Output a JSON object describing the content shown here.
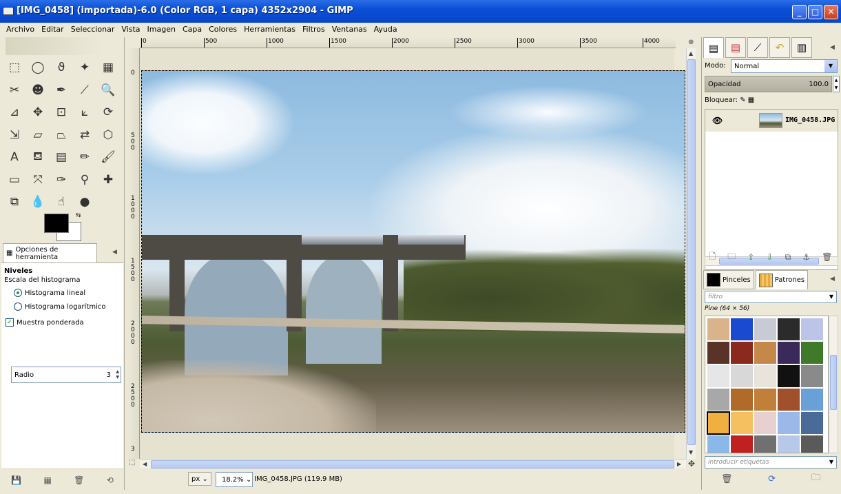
{
  "window": {
    "title": "[IMG_0458] (importada)-6.0 (Color RGB, 1 capa) 4352x2904 - GIMP",
    "minimize_glyph": "_",
    "maximize_glyph": "□",
    "close_glyph": "✕"
  },
  "menubar": [
    "Archivo",
    "Editar",
    "Seleccionar",
    "Vista",
    "Imagen",
    "Capa",
    "Colores",
    "Herramientas",
    "Filtros",
    "Ventanas",
    "Ayuda"
  ],
  "toolbox": {
    "tools": [
      {
        "name": "rect-select-icon",
        "glyph": "⬚"
      },
      {
        "name": "ellipse-select-icon",
        "glyph": "◯"
      },
      {
        "name": "free-select-icon",
        "glyph": "ϑ"
      },
      {
        "name": "fuzzy-select-icon",
        "glyph": "✦"
      },
      {
        "name": "select-by-color-icon",
        "glyph": "▦"
      },
      {
        "name": "scissors-select-icon",
        "glyph": "✂"
      },
      {
        "name": "foreground-select-icon",
        "glyph": "☻"
      },
      {
        "name": "paths-icon",
        "glyph": "✒"
      },
      {
        "name": "color-picker-icon",
        "glyph": "⟋"
      },
      {
        "name": "zoom-icon",
        "glyph": "🔍"
      },
      {
        "name": "measure-icon",
        "glyph": "⊿"
      },
      {
        "name": "move-icon",
        "glyph": "✥"
      },
      {
        "name": "align-icon",
        "glyph": "⊡"
      },
      {
        "name": "crop-icon",
        "glyph": "⟀"
      },
      {
        "name": "rotate-icon",
        "glyph": "⟳"
      },
      {
        "name": "scale-icon",
        "glyph": "⇲"
      },
      {
        "name": "shear-icon",
        "glyph": "▱"
      },
      {
        "name": "perspective-icon",
        "glyph": "⏢"
      },
      {
        "name": "flip-icon",
        "glyph": "⇄"
      },
      {
        "name": "cage-icon",
        "glyph": "⬡"
      },
      {
        "name": "text-icon",
        "glyph": "A"
      },
      {
        "name": "bucket-fill-icon",
        "glyph": "⛾"
      },
      {
        "name": "blend-icon",
        "glyph": "▤"
      },
      {
        "name": "pencil-icon",
        "glyph": "✏"
      },
      {
        "name": "paintbrush-icon",
        "glyph": "🖌"
      },
      {
        "name": "eraser-icon",
        "glyph": "▭"
      },
      {
        "name": "airbrush-icon",
        "glyph": "⤧"
      },
      {
        "name": "ink-icon",
        "glyph": "✑"
      },
      {
        "name": "clone-icon",
        "glyph": "⚲"
      },
      {
        "name": "heal-icon",
        "glyph": "✚"
      },
      {
        "name": "perspective-clone-icon",
        "glyph": "⧉"
      },
      {
        "name": "blur-icon",
        "glyph": "💧"
      },
      {
        "name": "smudge-icon",
        "glyph": "☝"
      },
      {
        "name": "dodge-burn-icon",
        "glyph": "●"
      }
    ],
    "swap_glyph": "⇆"
  },
  "tool_options": {
    "tab_label": "Opciones de herramienta",
    "close_glyph": "◀",
    "title": "Niveles",
    "subtitle": "Escala del histograma",
    "radio_linear": "Histograma lineal",
    "radio_log": "Histograma logarítmico",
    "check_label": "Muestra ponderada",
    "check_glyph": "✓",
    "radius_label": "Radio",
    "radius_value": "3"
  },
  "rulers": {
    "h_labels": [
      "0",
      "500",
      "1000",
      "1500",
      "2000",
      "2500",
      "3000",
      "3500",
      "4000"
    ],
    "v_labels": [
      "0",
      "500",
      "1000",
      "1500",
      "2000",
      "2500",
      "3"
    ]
  },
  "status": {
    "unit": "px",
    "zoom": "18.2%",
    "info": "IMG_0458.JPG (119.9 MB)"
  },
  "layers_panel": {
    "mode_label": "Modo:",
    "mode_value": "Normal",
    "opacity_label": "Opacidad",
    "opacity_value": "100.0",
    "lock_label": "Bloquear:",
    "layer_name": "IMG_0458.JPG",
    "close_glyph": "◀"
  },
  "brushes_panel": {
    "tab_brushes": "Pinceles",
    "tab_patterns": "Patrones",
    "filter_placeholder": "filtro",
    "pattern_name": "Pine (64 × 56)",
    "tags_placeholder": "introducir etiquetas",
    "close_glyph": "◀",
    "patterns": [
      "#d9b48a",
      "#1a4ad0",
      "#c9cbd4",
      "#2b2b2b",
      "#bcc4e8",
      "#5a3328",
      "#8a2a1e",
      "#c4884a",
      "#3a2a5a",
      "#3f7a2a",
      "#e6e6e6",
      "#d8d8d8",
      "#e8e4dc",
      "#111111",
      "#8a8a8a",
      "#a8a8a8",
      "#b06a2a",
      "#c0803a",
      "#a0502a",
      "#6aa0d8",
      "#f0b040",
      "#f4c060",
      "#e8d0d0",
      "#9cb8e8",
      "#4a6a9a",
      "#8ab8e8",
      "#c02020",
      "#707070",
      "#b8c8e8",
      "#5a5a5a"
    ]
  }
}
